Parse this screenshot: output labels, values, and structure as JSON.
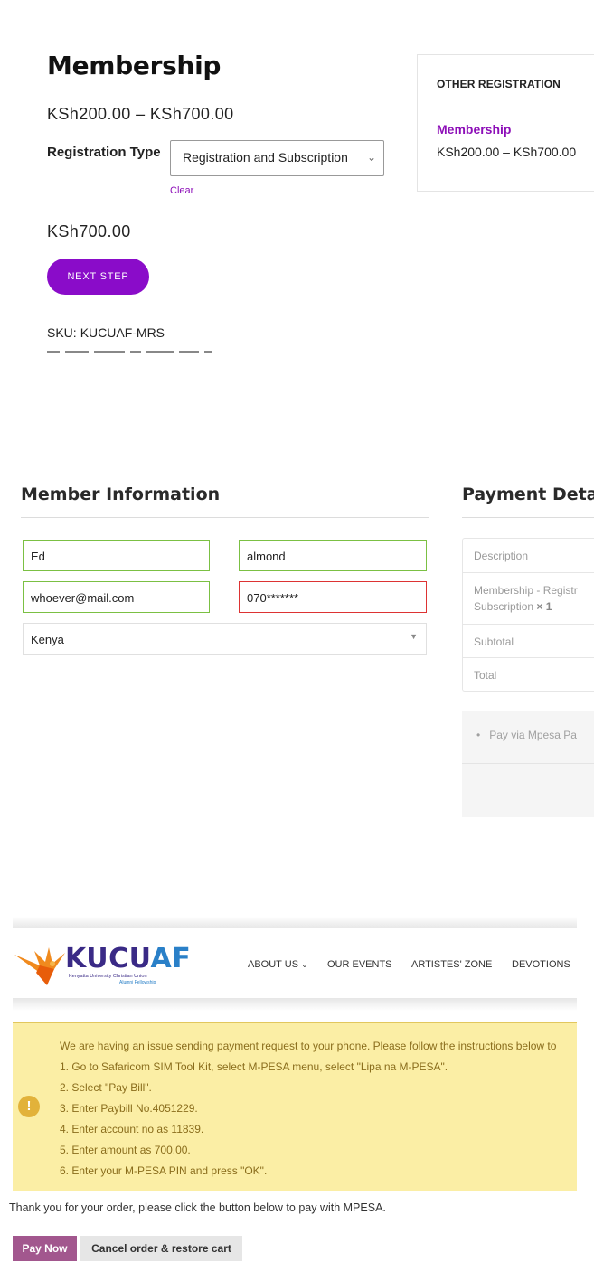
{
  "product": {
    "title": "Membership",
    "price_range": "KSh200.00 – KSh700.00",
    "registration_label": "Registration Type",
    "registration_value": "Registration and Subscription",
    "clear_label": "Clear",
    "selected_price": "KSh700.00",
    "next_label": "NEXT STEP",
    "sku_label": "SKU:",
    "sku_value": "KUCUAF-MRS"
  },
  "other_registration": {
    "heading": "OTHER REGISTRATION",
    "item_label": "Membership",
    "item_price": "KSh200.00 – KSh700.00"
  },
  "member_info": {
    "title": "Member Information",
    "first_name": "Ed",
    "last_name": "almond",
    "email": "whoever@mail.com",
    "phone": "070*******",
    "country": "Kenya"
  },
  "payment_details": {
    "title": "Payment Deta",
    "rows": {
      "description_head": "Description",
      "item_line1": "Membership - Registr",
      "item_line2": "Subscription",
      "item_qty": "× 1",
      "subtotal": "Subtotal",
      "total": "Total"
    },
    "gateway": "Pay via Mpesa Pa"
  },
  "site_header": {
    "logo_text_a": "KUCU",
    "logo_text_b": "AF",
    "logo_sub": "Kenyatta University Christian Union",
    "logo_sub2": "Alumni Fellowship",
    "nav": {
      "about": "ABOUT US",
      "events": "OUR EVENTS",
      "artistes": "ARTISTES' ZONE",
      "devotions": "DEVOTIONS"
    }
  },
  "notice": {
    "lines": [
      "We are having an issue sending payment request to your phone. Please follow the instructions below to",
      "1. Go to Safaricom SIM Tool Kit, select M-PESA menu, select \"Lipa na M-PESA\".",
      "2. Select \"Pay Bill\".",
      "3. Enter Paybill No.4051229.",
      "4. Enter account no as 11839.",
      "5. Enter amount as 700.00.",
      "6. Enter your M-PESA PIN and press \"OK\"."
    ]
  },
  "order": {
    "thanks": "Thank you for your order, please click the button below to pay with MPESA.",
    "pay_now": "Pay Now",
    "cancel": "Cancel order & restore cart"
  },
  "colors": {
    "brand_purple": "#8a0cc9",
    "notice_bg": "#fbeea5",
    "pay_now_bg": "#a2578e"
  }
}
